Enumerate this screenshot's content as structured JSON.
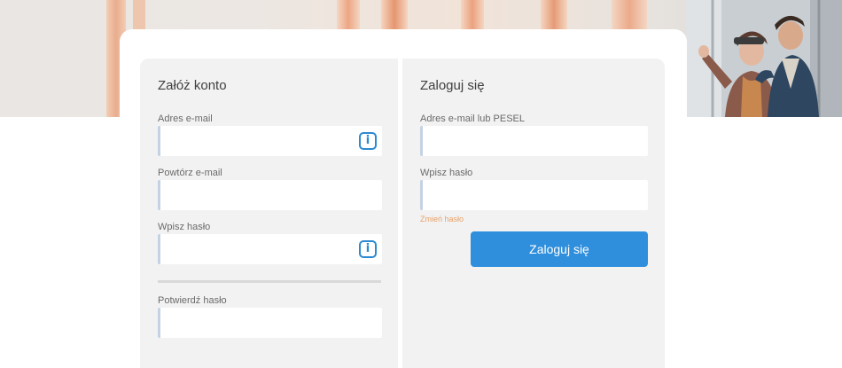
{
  "register": {
    "title": "Załóż konto",
    "email_label": "Adres e-mail",
    "email_value": "",
    "repeat_email_label": "Powtórz e-mail",
    "repeat_email_value": "",
    "password_label": "Wpisz hasło",
    "password_value": "",
    "confirm_password_label": "Potwierdź hasło",
    "confirm_password_value": "",
    "info_icon_glyph": "i"
  },
  "login": {
    "title": "Zaloguj się",
    "id_label": "Adres e-mail lub PESEL",
    "id_value": "",
    "password_label": "Wpisz hasło",
    "password_value": "",
    "change_password_link": "Zmień hasło",
    "submit_label": "Zaloguj się"
  },
  "colors": {
    "accent": "#2f8fdc",
    "link": "#e8a26a",
    "panel_bg": "#f2f2f2",
    "input_border": "#c3d3e3"
  },
  "icons": [
    "info-icon"
  ]
}
